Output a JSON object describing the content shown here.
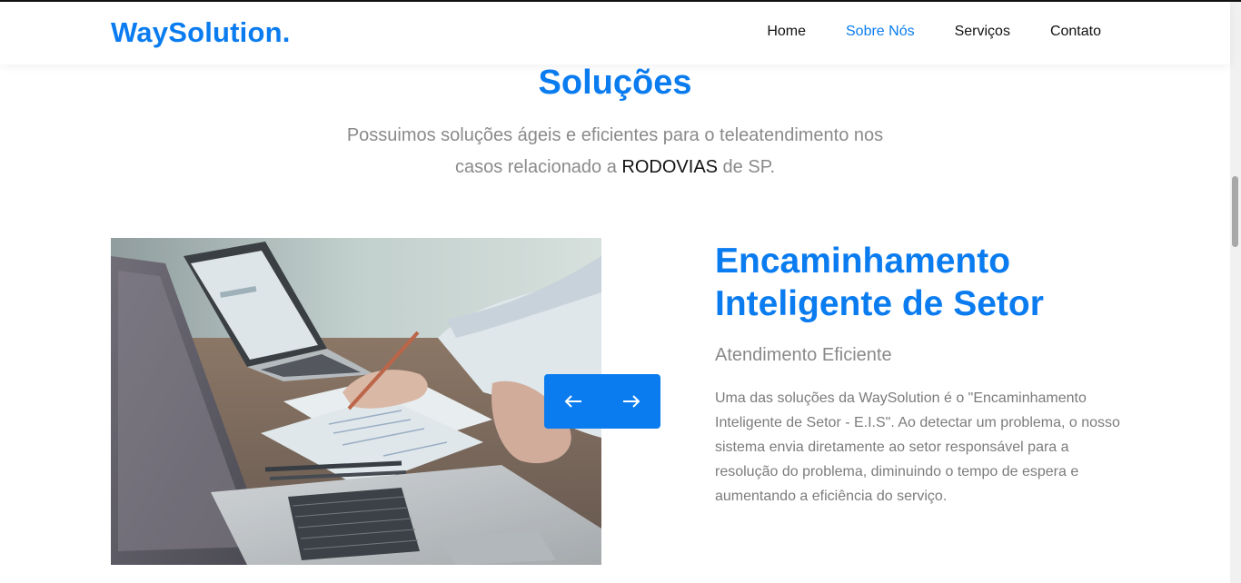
{
  "header": {
    "brand": "WaySolution.",
    "nav": [
      {
        "label": "Home",
        "active": false
      },
      {
        "label": "Sobre Nós",
        "active": true
      },
      {
        "label": "Serviços",
        "active": false
      },
      {
        "label": "Contato",
        "active": false
      }
    ]
  },
  "section": {
    "title": "Soluções",
    "subtitle_line1": "Possuimos soluções ágeis e eficientes para o teleatendimento nos",
    "subtitle_line2_pre": "casos relacionado a ",
    "subtitle_line2_em": "RODOVIAS",
    "subtitle_line2_post": " de SP."
  },
  "slide": {
    "title_line1": "Encaminhamento",
    "title_line2": "Inteligente de Setor",
    "subtitle": "Atendimento Eficiente",
    "description": "Uma das soluções da WaySolution é o \"Encaminhamento Inteligente de Setor - E.I.S\". Ao detectar um problema, o nosso sistema envia diretamente ao setor responsável para a resolução do problema, diminuindo o tempo de espera e aumentando a eficiência do serviço."
  },
  "controls": {
    "prev_icon": "arrow-left-icon",
    "next_icon": "arrow-right-icon"
  },
  "colors": {
    "accent": "#0a7cf0",
    "text_muted": "#8a8a8a",
    "text_dark": "#111111"
  }
}
